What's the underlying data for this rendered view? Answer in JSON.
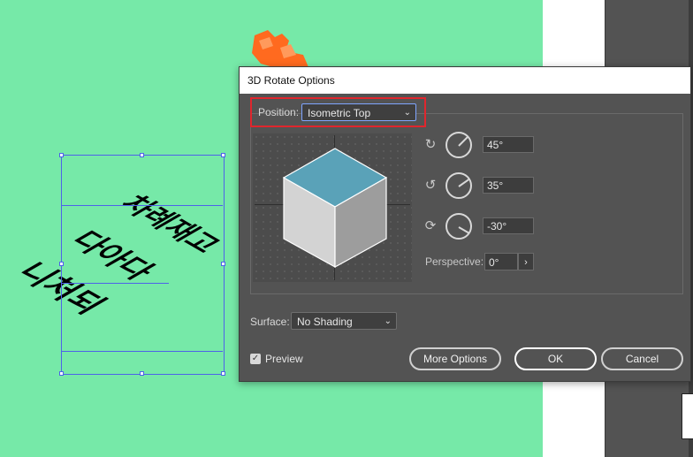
{
  "dialog": {
    "title": "3D Rotate Options",
    "position_label": "Position:",
    "position_value": "Isometric Top",
    "rotation": {
      "x": "45°",
      "y": "35°",
      "z": "-30°"
    },
    "perspective_label": "Perspective:",
    "perspective_value": "0°",
    "surface_label": "Surface:",
    "surface_value": "No Shading",
    "preview_label": "Preview",
    "preview_checked": true,
    "buttons": {
      "more_options": "More Options",
      "ok": "OK",
      "cancel": "Cancel"
    }
  },
  "canvas": {
    "artwork_lines": [
      "차례재고",
      "다아다",
      "니처되"
    ]
  },
  "colors": {
    "canvas_bg": "#76e9a8",
    "dialog_bg": "#535353",
    "highlight": "#e0262d",
    "selection": "#4e62e8",
    "cube_top": "#5aa2b8"
  },
  "icons": {
    "x_axis": "rotate-x-icon",
    "y_axis": "rotate-y-icon",
    "z_axis": "rotate-z-icon"
  }
}
